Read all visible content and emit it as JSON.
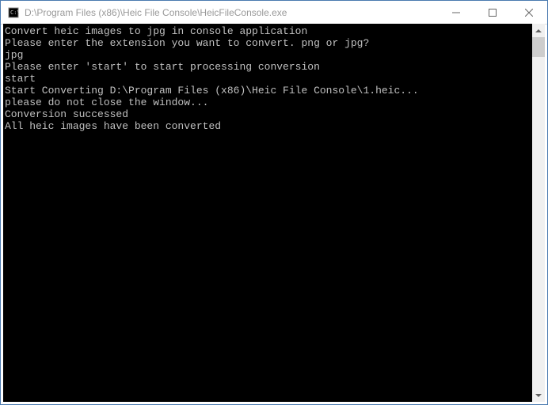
{
  "window": {
    "title": "D:\\Program Files (x86)\\Heic File Console\\HeicFileConsole.exe"
  },
  "console": {
    "lines": [
      "Convert heic images to jpg in console application",
      "Please enter the extension you want to convert. png or jpg?",
      "jpg",
      "Please enter 'start' to start processing conversion",
      "start",
      "Start Converting D:\\Program Files (x86)\\Heic File Console\\1.heic...",
      "please do not close the window...",
      "Conversion successed",
      "All heic images have been converted"
    ]
  }
}
